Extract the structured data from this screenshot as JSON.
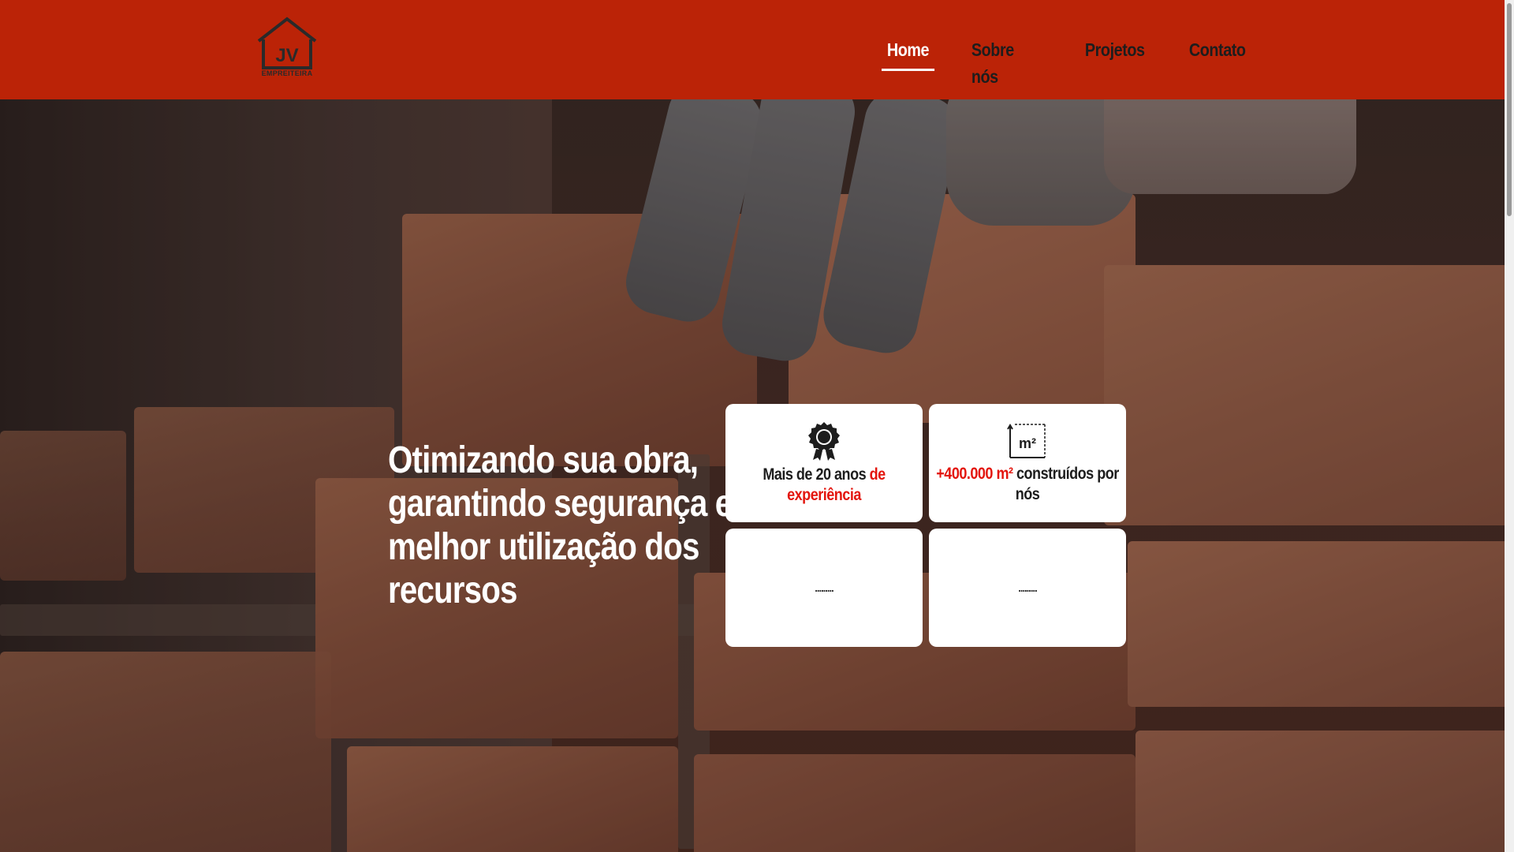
{
  "brand": {
    "logo_text": "JV",
    "logo_subtext": "EMPREITEIRA"
  },
  "nav": {
    "home": "Home",
    "sobre": "Sobre nós",
    "projetos": "Projetos",
    "contato": "Contato"
  },
  "hero": {
    "headline": "Otimizando sua obra, garantindo segurança e melhor utilização dos recursos"
  },
  "cards": {
    "experience": {
      "icon": "award-icon",
      "text_a": "Mais de 20 anos ",
      "text_b": "de experiência"
    },
    "area": {
      "icon": "area-m2-icon",
      "text_a": "+400.000 m²",
      "text_b": " construídos por nós"
    },
    "card3": {
      "text": "........."
    },
    "card4": {
      "text": "........."
    }
  },
  "colors": {
    "header_bg": "#bb2307",
    "accent": "#e3150d",
    "card_bg": "#ffffff"
  }
}
